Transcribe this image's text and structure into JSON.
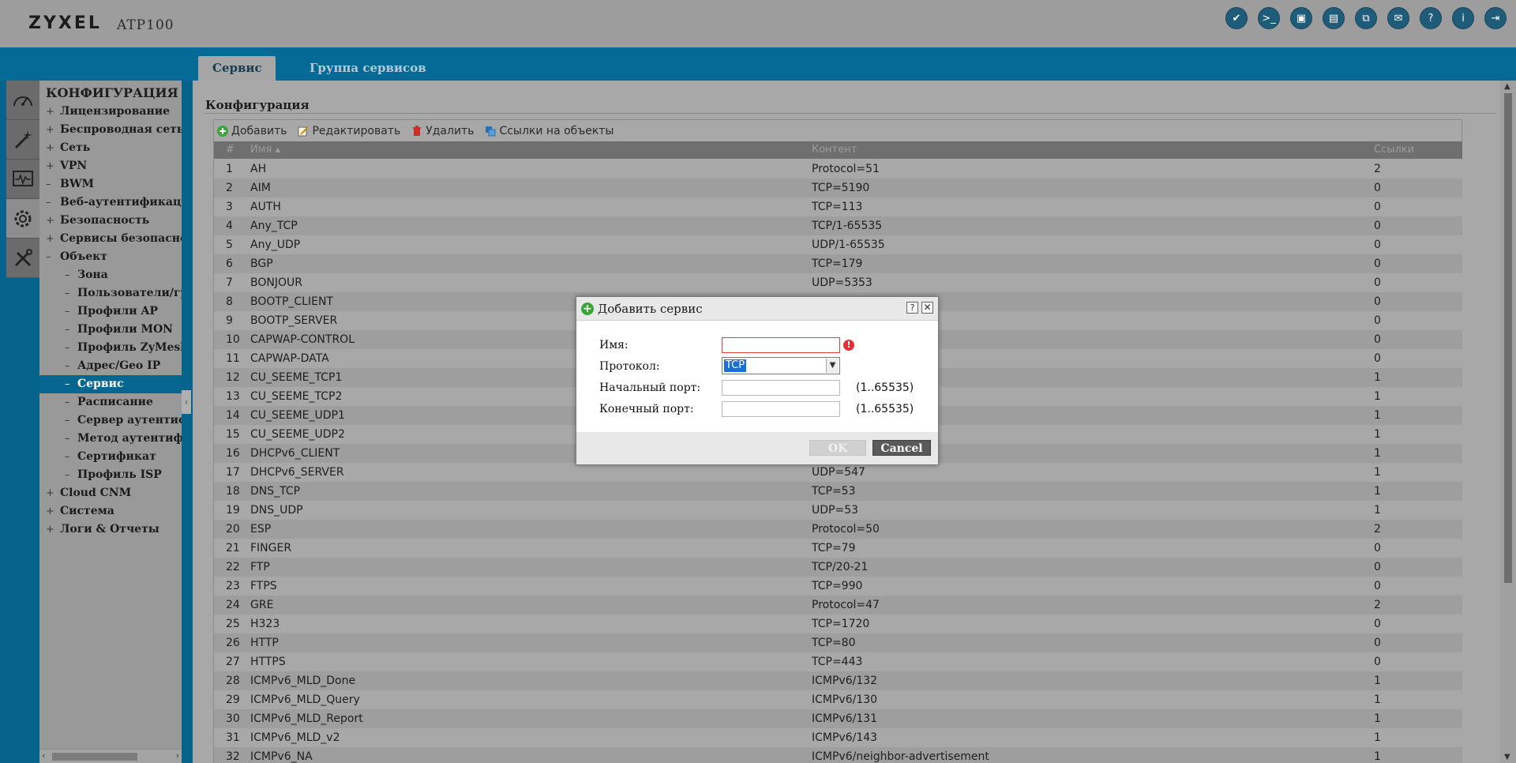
{
  "header": {
    "brand": "ZYXEL",
    "model": "ATP100",
    "icons": [
      {
        "name": "shield-icon",
        "glyph": "✔"
      },
      {
        "name": "console-icon",
        "glyph": ">_"
      },
      {
        "name": "cli-icon",
        "glyph": "▣"
      },
      {
        "name": "window-icon",
        "glyph": "▤"
      },
      {
        "name": "sitemap-icon",
        "glyph": "⧉"
      },
      {
        "name": "chat-icon",
        "glyph": "✉"
      },
      {
        "name": "help-icon",
        "glyph": "?"
      },
      {
        "name": "info-icon",
        "glyph": "i"
      },
      {
        "name": "logout-icon",
        "glyph": "⇥"
      }
    ]
  },
  "tabs": [
    {
      "label": "Сервис",
      "active": true
    },
    {
      "label": "Группа сервисов",
      "active": false
    }
  ],
  "sidebar": {
    "title": "КОНФИГУРАЦИЯ",
    "items": [
      {
        "pm": "+",
        "label": "Лицензирование",
        "sub": false
      },
      {
        "pm": "+",
        "label": "Беспроводная сеть",
        "sub": false
      },
      {
        "pm": "+",
        "label": "Сеть",
        "sub": false
      },
      {
        "pm": "+",
        "label": "VPN",
        "sub": false
      },
      {
        "pm": "–",
        "label": "BWM",
        "sub": false
      },
      {
        "pm": "–",
        "label": "Веб-аутентификация",
        "sub": false
      },
      {
        "pm": "+",
        "label": "Безопасность",
        "sub": false
      },
      {
        "pm": "+",
        "label": "Сервисы безопасности",
        "sub": false
      },
      {
        "pm": "–",
        "label": "Объект",
        "sub": false
      },
      {
        "pm": "–",
        "label": "Зона",
        "sub": true
      },
      {
        "pm": "–",
        "label": "Пользователи/группы",
        "sub": true
      },
      {
        "pm": "–",
        "label": "Профили AP",
        "sub": true
      },
      {
        "pm": "–",
        "label": "Профили MON",
        "sub": true
      },
      {
        "pm": "–",
        "label": "Профиль ZyMesh",
        "sub": true
      },
      {
        "pm": "–",
        "label": "Адрес/Geo IP",
        "sub": true
      },
      {
        "pm": "–",
        "label": "Сервис",
        "sub": true,
        "selected": true
      },
      {
        "pm": "–",
        "label": "Расписание",
        "sub": true
      },
      {
        "pm": "–",
        "label": "Сервер аутентификации",
        "sub": true
      },
      {
        "pm": "–",
        "label": "Метод аутентификации",
        "sub": true
      },
      {
        "pm": "–",
        "label": "Сертификат",
        "sub": true
      },
      {
        "pm": "–",
        "label": "Профиль ISP",
        "sub": true
      },
      {
        "pm": "+",
        "label": "Cloud CNM",
        "sub": false
      },
      {
        "pm": "+",
        "label": "Система",
        "sub": false
      },
      {
        "pm": "+",
        "label": "Логи & Отчеты",
        "sub": false
      }
    ]
  },
  "main": {
    "section_title": "Конфигурация",
    "toolbar": {
      "add": "Добавить",
      "edit": "Редактировать",
      "delete": "Удалить",
      "refs": "Ссылки на объекты"
    },
    "columns": {
      "num": "#",
      "name": "Имя ▴",
      "content": "Контент",
      "refs": "Ссылки"
    },
    "rows": [
      {
        "num": "1",
        "name": "AH",
        "content": "Protocol=51",
        "refs": "2"
      },
      {
        "num": "2",
        "name": "AIM",
        "content": "TCP=5190",
        "refs": "0"
      },
      {
        "num": "3",
        "name": "AUTH",
        "content": "TCP=113",
        "refs": "0"
      },
      {
        "num": "4",
        "name": "Any_TCP",
        "content": "TCP/1-65535",
        "refs": "0"
      },
      {
        "num": "5",
        "name": "Any_UDP",
        "content": "UDP/1-65535",
        "refs": "0"
      },
      {
        "num": "6",
        "name": "BGP",
        "content": "TCP=179",
        "refs": "0"
      },
      {
        "num": "7",
        "name": "BONJOUR",
        "content": "UDP=5353",
        "refs": "0"
      },
      {
        "num": "8",
        "name": "BOOTP_CLIENT",
        "content": "",
        "refs": "0"
      },
      {
        "num": "9",
        "name": "BOOTP_SERVER",
        "content": "",
        "refs": "0"
      },
      {
        "num": "10",
        "name": "CAPWAP-CONTROL",
        "content": "",
        "refs": "0"
      },
      {
        "num": "11",
        "name": "CAPWAP-DATA",
        "content": "",
        "refs": "0"
      },
      {
        "num": "12",
        "name": "CU_SEEME_TCP1",
        "content": "",
        "refs": "1"
      },
      {
        "num": "13",
        "name": "CU_SEEME_TCP2",
        "content": "",
        "refs": "1"
      },
      {
        "num": "14",
        "name": "CU_SEEME_UDP1",
        "content": "",
        "refs": "1"
      },
      {
        "num": "15",
        "name": "CU_SEEME_UDP2",
        "content": "",
        "refs": "1"
      },
      {
        "num": "16",
        "name": "DHCPv6_CLIENT",
        "content": "",
        "refs": "1"
      },
      {
        "num": "17",
        "name": "DHCPv6_SERVER",
        "content": "UDP=547",
        "refs": "1"
      },
      {
        "num": "18",
        "name": "DNS_TCP",
        "content": "TCP=53",
        "refs": "1"
      },
      {
        "num": "19",
        "name": "DNS_UDP",
        "content": "UDP=53",
        "refs": "1"
      },
      {
        "num": "20",
        "name": "ESP",
        "content": "Protocol=50",
        "refs": "2"
      },
      {
        "num": "21",
        "name": "FINGER",
        "content": "TCP=79",
        "refs": "0"
      },
      {
        "num": "22",
        "name": "FTP",
        "content": "TCP/20-21",
        "refs": "0"
      },
      {
        "num": "23",
        "name": "FTPS",
        "content": "TCP=990",
        "refs": "0"
      },
      {
        "num": "24",
        "name": "GRE",
        "content": "Protocol=47",
        "refs": "2"
      },
      {
        "num": "25",
        "name": "H323",
        "content": "TCP=1720",
        "refs": "0"
      },
      {
        "num": "26",
        "name": "HTTP",
        "content": "TCP=80",
        "refs": "0"
      },
      {
        "num": "27",
        "name": "HTTPS",
        "content": "TCP=443",
        "refs": "0"
      },
      {
        "num": "28",
        "name": "ICMPv6_MLD_Done",
        "content": "ICMPv6/132",
        "refs": "1"
      },
      {
        "num": "29",
        "name": "ICMPv6_MLD_Query",
        "content": "ICMPv6/130",
        "refs": "1"
      },
      {
        "num": "30",
        "name": "ICMPv6_MLD_Report",
        "content": "ICMPv6/131",
        "refs": "1"
      },
      {
        "num": "31",
        "name": "ICMPv6_MLD_v2",
        "content": "ICMPv6/143",
        "refs": "1"
      },
      {
        "num": "32",
        "name": "ICMPv6_NA",
        "content": "ICMPv6/neighbor-advertisement",
        "refs": "1"
      }
    ]
  },
  "dialog": {
    "title": "Добавить сервис",
    "help": "?",
    "close": "✕",
    "fields": {
      "name_label": "Имя:",
      "name_value": "",
      "protocol_label": "Протокол:",
      "protocol_value": "TCP",
      "start_port_label": "Начальный порт:",
      "start_port_value": "",
      "end_port_label": "Конечный порт:",
      "end_port_value": "",
      "range_hint": "(1..65535)"
    },
    "ok_label": "OK",
    "cancel_label": "Cancel",
    "error_glyph": "!"
  },
  "colors": {
    "brand_blue": "#05638c",
    "error_red": "#e0303a",
    "add_green": "#3aa63a"
  }
}
